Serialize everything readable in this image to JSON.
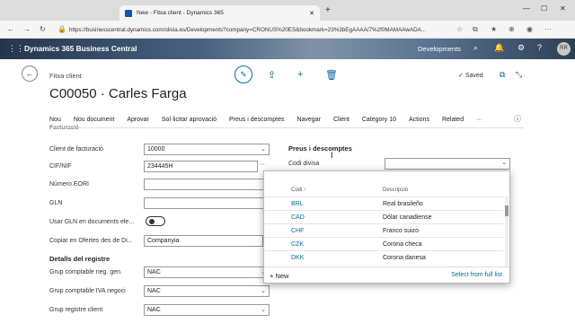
{
  "browser": {
    "tab_title": "New - Fitxa client - Dynamics 365",
    "new_tab": "+",
    "url": "https://businesscentral.dynamics.com/olivia.es/Developments?company=CRONUS%20ES&bookmark=23%3bEgAAAA/7%2f0MAMAAwADA..."
  },
  "app": {
    "name": "Dynamics 365 Business Central",
    "company": "Developments",
    "avatar": "RR"
  },
  "header": {
    "caption": "Fitxa client",
    "title": "C00050 · Carles Farga",
    "saved_label": "Saved"
  },
  "actions": [
    "Nou",
    "Nou document",
    "Aprovar",
    "Sol·licitar aprovació",
    "Preus i descomptes",
    "Navegar",
    "Client",
    "Category 10",
    "Actions",
    "Related",
    "···"
  ],
  "fasttab": {
    "title": "Facturació"
  },
  "fields": {
    "client_facturacio": {
      "label": "Client de facturació",
      "value": "10000"
    },
    "cif_nif": {
      "label": "CIF/NIF",
      "value": "234445H"
    },
    "numero_eori": {
      "label": "Número EORI",
      "value": ""
    },
    "gln": {
      "label": "GLN",
      "value": ""
    },
    "usar_gln": {
      "label": "Usar GLN en documents ele..."
    },
    "copiar_ofertes": {
      "label": "Copiar en Ofertes des de Di...",
      "value": "Companyia"
    },
    "details_title": "Detalls del registre",
    "grup_neg": {
      "label": "Grup comptable neg. gen.",
      "value": "NAC"
    },
    "grup_iva": {
      "label": "Grup comptable IVA negoci",
      "value": "NAC"
    },
    "grup_registre": {
      "label": "Grup registre client",
      "value": "NAC"
    }
  },
  "right": {
    "section_title": "Preus i descomptes",
    "codi_divisa_label": "Codi divisa"
  },
  "lookup": {
    "col_code": "Codi ↑",
    "col_desc": "Descripció",
    "rows": [
      {
        "code": "BRL",
        "desc": "Real brasileño"
      },
      {
        "code": "CAD",
        "desc": "Dólar canadiense"
      },
      {
        "code": "CHF",
        "desc": "Franco suizo"
      },
      {
        "code": "CZK",
        "desc": "Corona checa"
      },
      {
        "code": "DKK",
        "desc": "Corona danesa"
      }
    ],
    "new_label": "+ New",
    "full_list_label": "Select from full list"
  }
}
